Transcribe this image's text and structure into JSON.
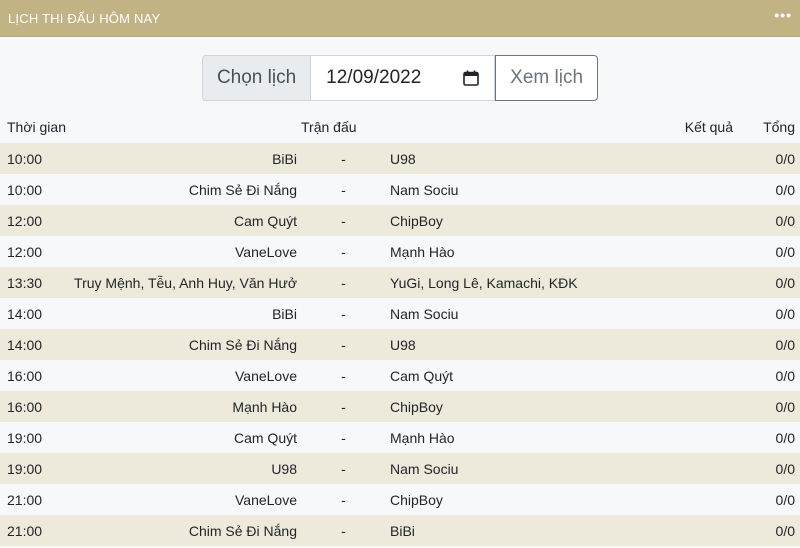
{
  "header": {
    "title": "LỊCH THI ĐẤU HÔM NAY",
    "menu_icon": "more-horizontal-icon"
  },
  "controls": {
    "addon_label": "Chọn lịch",
    "date_value": "12/09/2022",
    "view_button_label": "Xem lịch"
  },
  "table": {
    "headers": {
      "time": "Thời gian",
      "match": "Trận đấu",
      "result": "Kết quả",
      "total": "Tổng"
    },
    "rows": [
      {
        "time": "10:00",
        "home": "BiBi",
        "sep": "-",
        "away": "U98",
        "result": "",
        "total": "0/0"
      },
      {
        "time": "10:00",
        "home": "Chim Sẻ Đi Nắng",
        "sep": "-",
        "away": "Nam Sociu",
        "result": "",
        "total": "0/0"
      },
      {
        "time": "12:00",
        "home": "Cam Quýt",
        "sep": "-",
        "away": "ChipBoy",
        "result": "",
        "total": "0/0"
      },
      {
        "time": "12:00",
        "home": "VaneLove",
        "sep": "-",
        "away": "Mạnh Hào",
        "result": "",
        "total": "0/0"
      },
      {
        "time": "13:30",
        "home": "Truy Mệnh, Tễu, Anh Huy, Văn Hưở",
        "sep": "-",
        "away": "YuGi, Long Lê, Kamachi, KĐK",
        "result": "",
        "total": "0/0"
      },
      {
        "time": "14:00",
        "home": "BiBi",
        "sep": "-",
        "away": "Nam Sociu",
        "result": "",
        "total": "0/0"
      },
      {
        "time": "14:00",
        "home": "Chim Sẻ Đi Nắng",
        "sep": "-",
        "away": "U98",
        "result": "",
        "total": "0/0"
      },
      {
        "time": "16:00",
        "home": "VaneLove",
        "sep": "-",
        "away": "Cam Quýt",
        "result": "",
        "total": "0/0"
      },
      {
        "time": "16:00",
        "home": "Mạnh Hào",
        "sep": "-",
        "away": "ChipBoy",
        "result": "",
        "total": "0/0"
      },
      {
        "time": "19:00",
        "home": "Cam Quýt",
        "sep": "-",
        "away": "Mạnh Hào",
        "result": "",
        "total": "0/0"
      },
      {
        "time": "19:00",
        "home": "U98",
        "sep": "-",
        "away": "Nam Sociu",
        "result": "",
        "total": "0/0"
      },
      {
        "time": "21:00",
        "home": "VaneLove",
        "sep": "-",
        "away": "ChipBoy",
        "result": "",
        "total": "0/0"
      },
      {
        "time": "21:00",
        "home": "Chim Sẻ Đi Nắng",
        "sep": "-",
        "away": "BiBi",
        "result": "",
        "total": "0/0"
      }
    ]
  },
  "colors": {
    "header_bg": "#c2b385",
    "row_stripe": "#eeeadb",
    "page_bg": "#f7f8fa"
  }
}
